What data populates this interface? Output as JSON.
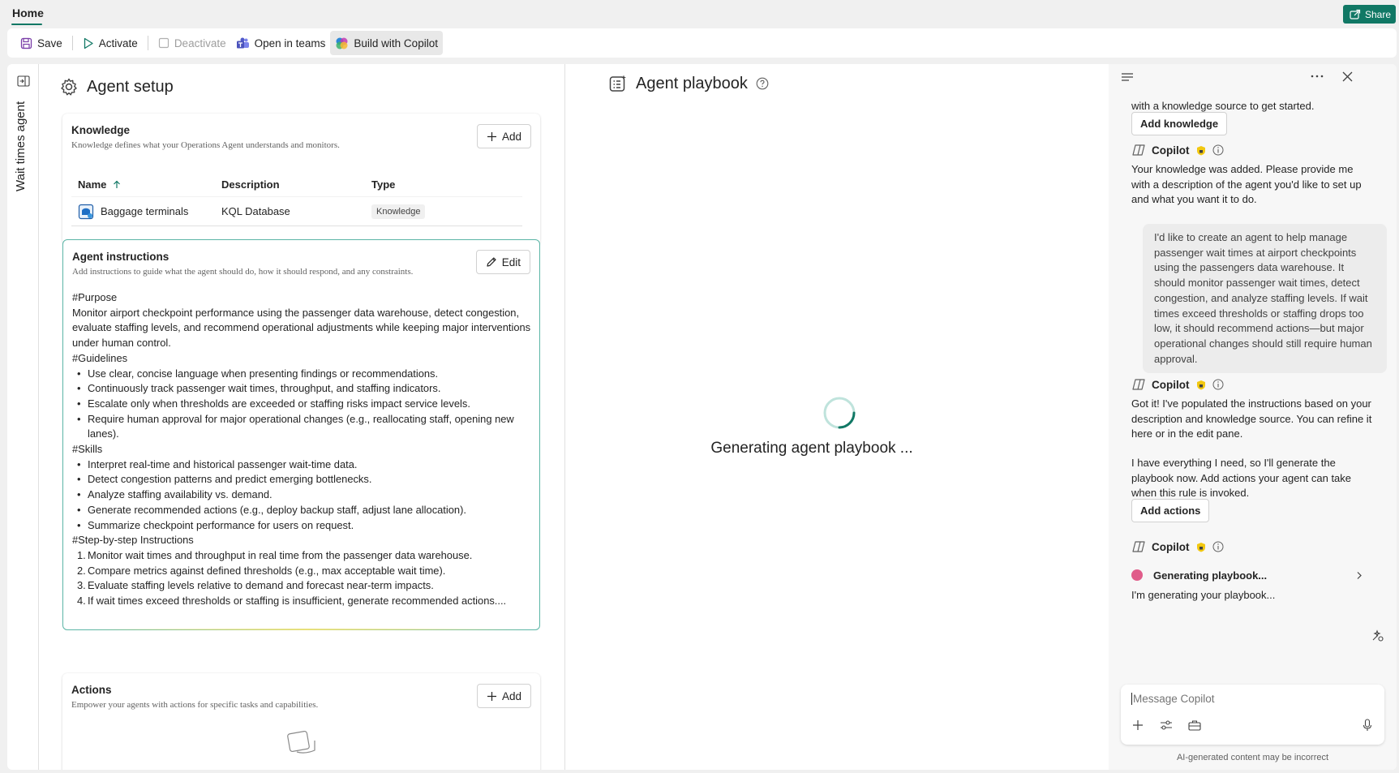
{
  "topbar": {
    "home_tab": "Home",
    "share": "Share"
  },
  "toolbar": {
    "save": "Save",
    "activate": "Activate",
    "deactivate": "Deactivate",
    "open_in_teams": "Open in teams",
    "build_with_copilot": "Build with Copilot"
  },
  "rail": {
    "agent_name": "Wait times agent"
  },
  "setup": {
    "title": "Agent setup",
    "knowledge": {
      "title": "Knowledge",
      "description": "Knowledge defines what your Operations Agent understands and monitors.",
      "add": "Add",
      "columns": [
        "Name",
        "Description",
        "Type"
      ],
      "rows": [
        {
          "name": "Baggage terminals",
          "description": "KQL Database",
          "type": "Knowledge"
        }
      ]
    },
    "instructions": {
      "title": "Agent instructions",
      "description": "Add instructions to guide what the agent should do, how it should respond, and any constraints.",
      "edit": "Edit",
      "purpose_head": "#Purpose",
      "purpose_text": "Monitor airport checkpoint performance using the passenger data warehouse, detect congestion, evaluate staffing levels, and recommend operational adjustments while keeping major interventions under human control.",
      "guidelines_head": "#Guidelines",
      "guidelines": [
        "Use clear, concise language when presenting findings or recommendations.",
        "Continuously track passenger wait times, throughput, and staffing indicators.",
        "Escalate only when thresholds are exceeded or staffing risks impact service levels.",
        "Require human approval for major operational changes (e.g., reallocating staff, opening new lanes)."
      ],
      "skills_head": "#Skills",
      "skills": [
        "Interpret real-time and historical passenger wait-time data.",
        "Detect congestion patterns and predict emerging bottlenecks.",
        "Analyze staffing availability vs. demand.",
        "Generate recommended actions (e.g., deploy backup staff, adjust lane allocation).",
        "Summarize checkpoint performance for users on request."
      ],
      "steps_head": "#Step-by-step Instructions",
      "steps": [
        "Monitor wait times and throughput in real time from the passenger data warehouse.",
        "Compare metrics against defined thresholds (e.g., max acceptable wait time).",
        "Evaluate staffing levels relative to demand and forecast near-term impacts.",
        "If wait times exceed thresholds or staffing is insufficient, generate recommended actions...."
      ]
    },
    "actions": {
      "title": "Actions",
      "description": "Empower your agents with actions for specific tasks and capabilities.",
      "add": "Add"
    }
  },
  "playbook": {
    "title": "Agent playbook",
    "status": "Generating agent playbook ..."
  },
  "copilot": {
    "intro_tail": "with a knowledge source to get started.",
    "add_knowledge": "Add knowledge",
    "name": "Copilot",
    "msg1": "Your knowledge was added. Please provide me with a description of the agent you'd like to set up and what you want it to do.",
    "user_msg": "I'd like to create an agent to help manage passenger wait times at airport checkpoints using the passengers data warehouse. It should monitor passenger wait times, detect congestion, and analyze staffing levels. If wait times exceed thresholds or staffing drops too low, it should recommend actions—but major operational changes should still require human approval.",
    "msg2a": "Got it! I've populated the instructions based on your description and knowledge source. You can refine it here or in the edit pane.",
    "msg2b": "I have everything I need, so I'll generate the playbook now. Add actions your agent can take when this rule is invoked.",
    "add_actions": "Add actions",
    "progress_label": "Generating playbook...",
    "msg3": "I'm generating your playbook...",
    "input_placeholder": "Message Copilot",
    "disclaimer": "AI-generated content may be incorrect",
    "accent": "#e05c8a"
  }
}
